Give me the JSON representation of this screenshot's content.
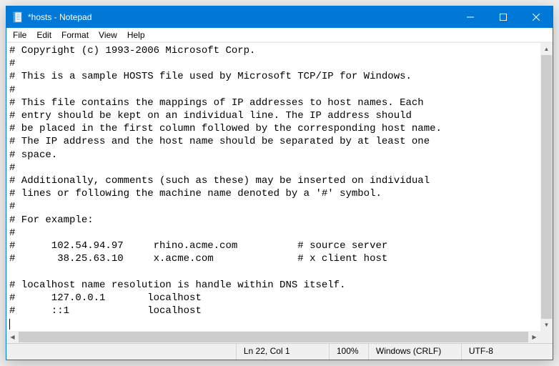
{
  "window": {
    "title": "*hosts - Notepad"
  },
  "menus": {
    "file": "File",
    "edit": "Edit",
    "format": "Format",
    "view": "View",
    "help": "Help"
  },
  "content": "# Copyright (c) 1993-2006 Microsoft Corp.\n#\n# This is a sample HOSTS file used by Microsoft TCP/IP for Windows.\n#\n# This file contains the mappings of IP addresses to host names. Each\n# entry should be kept on an individual line. The IP address should\n# be placed in the first column followed by the corresponding host name.\n# The IP address and the host name should be separated by at least one\n# space.\n#\n# Additionally, comments (such as these) may be inserted on individual\n# lines or following the machine name denoted by a '#' symbol.\n#\n# For example:\n#\n#      102.54.94.97     rhino.acme.com          # source server\n#       38.25.63.10     x.acme.com              # x client host\n\n# localhost name resolution is handle within DNS itself.\n#      127.0.0.1       localhost\n#      ::1             localhost\n",
  "status": {
    "position": "Ln 22, Col 1",
    "zoom": "100%",
    "line_ending": "Windows (CRLF)",
    "encoding": "UTF-8"
  }
}
